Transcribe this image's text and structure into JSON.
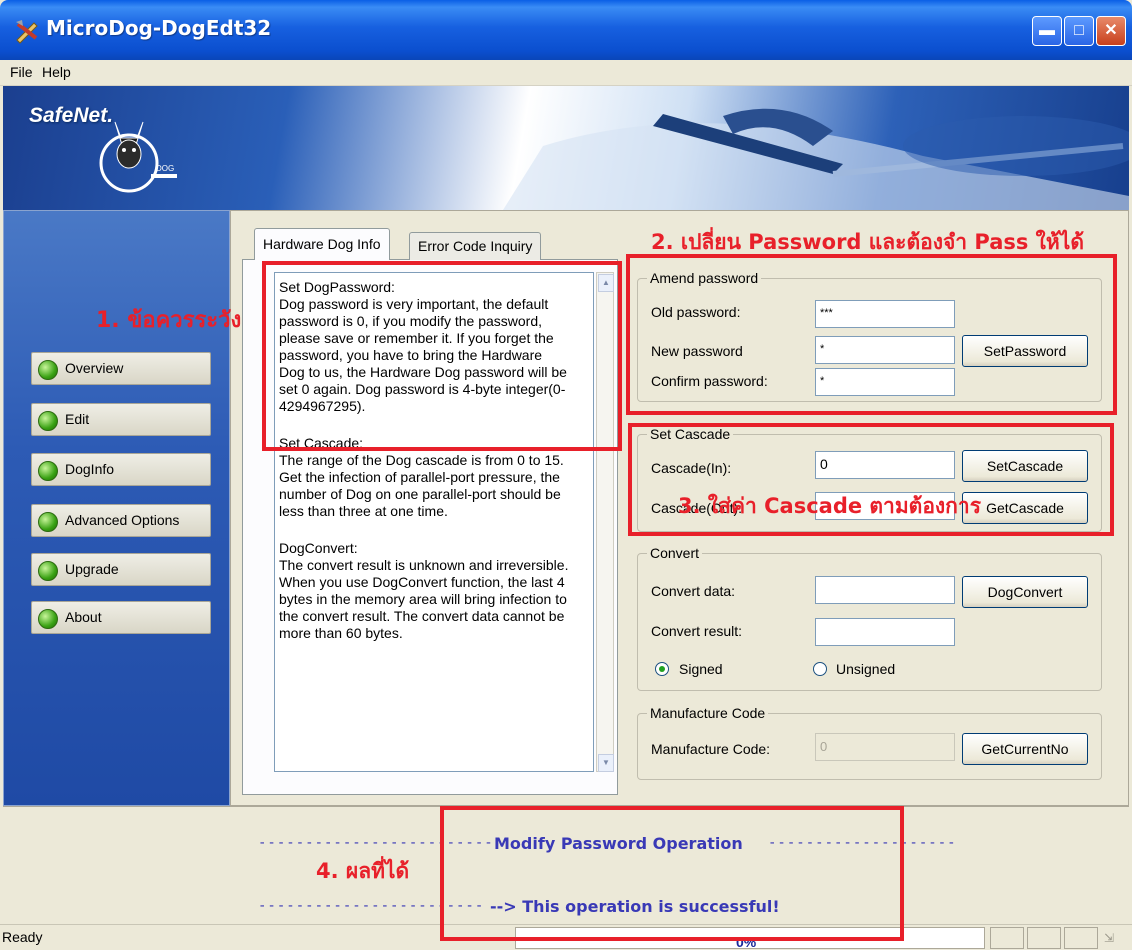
{
  "window": {
    "title": "MicroDog-DogEdt32"
  },
  "menu": {
    "file": "File",
    "help": "Help"
  },
  "banner": {
    "brand": "SafeNet.",
    "dog_tag": "DOG"
  },
  "sidebar": {
    "items": [
      {
        "label": "Overview"
      },
      {
        "label": "Edit"
      },
      {
        "label": "DogInfo"
      },
      {
        "label": "Advanced Options"
      },
      {
        "label": "Upgrade"
      },
      {
        "label": "About"
      }
    ]
  },
  "tabs": {
    "hardware": "Hardware Dog Info",
    "error": "Error Code Inquiry"
  },
  "info": {
    "p1": "Set DogPassword:\nDog password is very important, the default password is 0, if you modify the password, please save or remember it. If you forget the password, you have to bring the Hardware Dog to us, the Hardware Dog password will be set 0 again. Dog password is 4-byte integer(0-4294967295).",
    "p2": "Set Cascade:\nThe range of the Dog cascade is from 0 to 15. Get the infection of parallel-port pressure, the number of Dog on one parallel-port should be less than three at one time.",
    "p3": "DogConvert:\nThe convert result is unknown and irreversible. When you use DogConvert function, the last 4 bytes in the memory area will bring infection to the convert result. The convert data cannot be more than 60 bytes."
  },
  "amend": {
    "title": "Amend password",
    "old_label": "Old password:",
    "old_value": "***",
    "new_label": "New password",
    "new_value": "*",
    "confirm_label": "Confirm password:",
    "confirm_value": "*",
    "set_button": "SetPassword"
  },
  "cascade": {
    "title": "Set Cascade",
    "in_label": "Cascade(In):",
    "in_value": "0",
    "out_label": "Cascade(Out):",
    "set_button": "SetCascade",
    "get_button": "GetCascade"
  },
  "convert": {
    "title": "Convert",
    "data_label": "Convert data:",
    "result_label": "Convert result:",
    "button": "DogConvert",
    "signed": "Signed",
    "unsigned": "Unsigned",
    "selected": "Signed"
  },
  "manufacture": {
    "title": "Manufacture Code",
    "label": "Manufacture Code:",
    "value": "0",
    "button": "GetCurrentNo"
  },
  "messages": {
    "operation": "Modify Password Operation",
    "result": "--> This operation is successful!",
    "dashes_left_1": "-------------------------",
    "dashes_right_1": "--------------------",
    "dashes_left_2": "------------------------"
  },
  "status": {
    "text": "Ready",
    "progress": "0%",
    "progress_value": 0
  },
  "annotations": {
    "a1": "1. ข้อควรระวัง",
    "a2": "2. เปลี่ยน Password และต้องจำ Pass ให้ได้",
    "a3": "3. ใส่ค่า Cascade ตามต้องการ",
    "a4": "4. ผลที่ได้"
  },
  "colors": {
    "titlebar": "#0a5fe6",
    "sidebar": "#2d5bb5",
    "message": "#3939b6",
    "annotation": "#e8202a"
  }
}
